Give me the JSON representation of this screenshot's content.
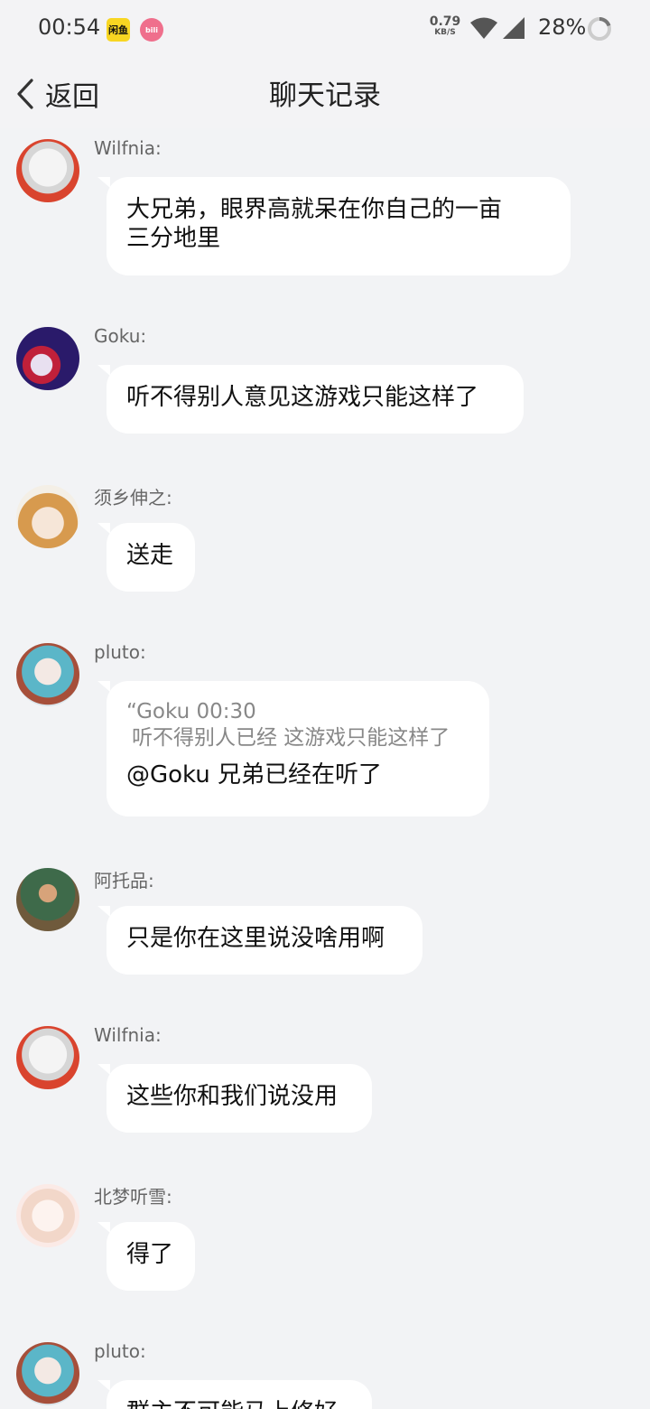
{
  "status_bar": {
    "time": "00:54",
    "app_badge_1": "闲鱼",
    "app_badge_2": "bili",
    "net_speed_value": "0.79",
    "net_speed_unit": "KB/S",
    "battery": "28%"
  },
  "header": {
    "back_label": "返回",
    "title": "聊天记录"
  },
  "messages": [
    {
      "sender": "Wilfnia:",
      "text_line1": "大兄弟，眼界高就呆在你自己的一亩",
      "text_line2": "三分地里"
    },
    {
      "sender": "Goku:",
      "text": "听不得别人意见这游戏只能这样了"
    },
    {
      "sender": "须乡伸之:",
      "text": "送走"
    },
    {
      "sender": "pluto:",
      "quote_head": "“Goku 00:30",
      "quote_text": "听不得别人已经  这游戏只能这样了",
      "text": "@Goku 兄弟已经在听了"
    },
    {
      "sender": "阿托品:",
      "text": "只是你在这里说没啥用啊"
    },
    {
      "sender": "Wilfnia:",
      "text": "这些你和我们说没用"
    },
    {
      "sender": "北梦听雪:",
      "text": "得了"
    },
    {
      "sender": "pluto:",
      "text": "群主不可能马上修好"
    }
  ],
  "colors": {
    "background": "#f2f3f5",
    "bubble": "#ffffff",
    "sender_text": "#666666",
    "quote_text": "#888888"
  },
  "icons": [
    "chevron-left-icon",
    "wifi-icon",
    "signal-icon",
    "battery-icon"
  ]
}
